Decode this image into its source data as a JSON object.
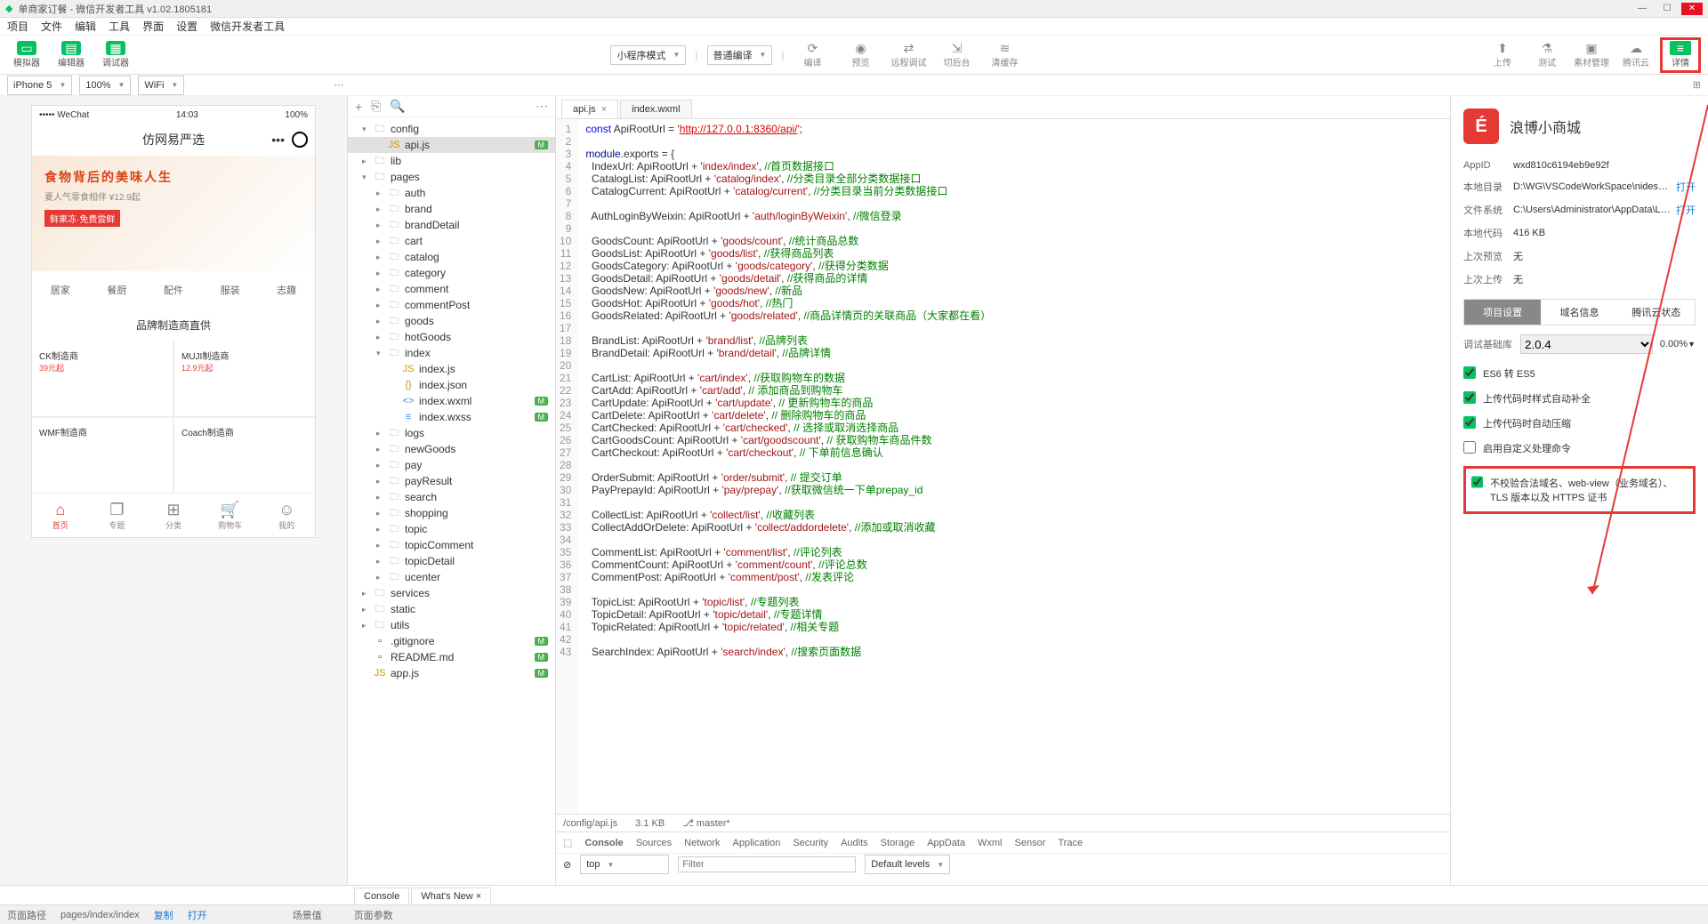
{
  "window": {
    "title": "单商家订餐 - 微信开发者工具 v1.02.1805181"
  },
  "menu": [
    "项目",
    "文件",
    "编辑",
    "工具",
    "界面",
    "设置",
    "微信开发者工具"
  ],
  "toolbar": {
    "sim": "模拟器",
    "editor": "编辑器",
    "debug": "调试器",
    "mode": "小程序模式",
    "compile_mode": "普通编译",
    "compile": "编译",
    "preview": "预览",
    "remote": "远程调试",
    "bg": "切后台",
    "cache": "清缓存",
    "upload": "上传",
    "test": "测试",
    "material": "素材管理",
    "cloud": "腾讯云",
    "detail": "详情"
  },
  "device": {
    "name": "iPhone 5",
    "zoom": "100%",
    "network": "WiFi"
  },
  "phone": {
    "carrier": "••••• WeChat",
    "sig": "⌁",
    "time": "14:03",
    "bat": "100%",
    "title": "仿网易严选",
    "banner": {
      "h": "食物背后的美味人生",
      "p": "夏人气零食相伴 ¥12.9起",
      "tag": "鲜果冻·免费尝鲜"
    },
    "navtabs": [
      "居家",
      "餐厨",
      "配件",
      "服装",
      "志趣"
    ],
    "brand_title": "品牌制造商直供",
    "brands": [
      {
        "name": "CK制造商",
        "price": "39元起"
      },
      {
        "name": "MUJI制造商",
        "price": "12.9元起"
      },
      {
        "name": "WMF制造商",
        "price": ""
      },
      {
        "name": "Coach制造商",
        "price": ""
      }
    ],
    "tabbar": [
      {
        "icon": "⌂",
        "label": "首页"
      },
      {
        "icon": "❐",
        "label": "专题"
      },
      {
        "icon": "⊞",
        "label": "分类"
      },
      {
        "icon": "🛒",
        "label": "购物车"
      },
      {
        "icon": "☺",
        "label": "我的"
      }
    ]
  },
  "tree_head_icons": [
    "+",
    "⎘",
    "Q"
  ],
  "files": [
    {
      "d": 1,
      "t": "folder",
      "open": true,
      "n": "config"
    },
    {
      "d": 2,
      "t": "js",
      "n": "api.js",
      "badge": "M",
      "sel": true,
      "green": true
    },
    {
      "d": 1,
      "t": "folder",
      "open": false,
      "n": "lib"
    },
    {
      "d": 1,
      "t": "folder",
      "open": true,
      "n": "pages"
    },
    {
      "d": 2,
      "t": "folder",
      "open": false,
      "n": "auth"
    },
    {
      "d": 2,
      "t": "folder",
      "open": false,
      "n": "brand"
    },
    {
      "d": 2,
      "t": "folder",
      "open": false,
      "n": "brandDetail"
    },
    {
      "d": 2,
      "t": "folder",
      "open": false,
      "n": "cart"
    },
    {
      "d": 2,
      "t": "folder",
      "open": false,
      "n": "catalog"
    },
    {
      "d": 2,
      "t": "folder",
      "open": false,
      "n": "category"
    },
    {
      "d": 2,
      "t": "folder",
      "open": false,
      "n": "comment"
    },
    {
      "d": 2,
      "t": "folder",
      "open": false,
      "n": "commentPost"
    },
    {
      "d": 2,
      "t": "folder",
      "open": false,
      "n": "goods"
    },
    {
      "d": 2,
      "t": "folder",
      "open": false,
      "n": "hotGoods"
    },
    {
      "d": 2,
      "t": "folder",
      "open": true,
      "n": "index"
    },
    {
      "d": 3,
      "t": "js",
      "n": "index.js"
    },
    {
      "d": 3,
      "t": "json",
      "n": "index.json"
    },
    {
      "d": 3,
      "t": "wxml",
      "n": "index.wxml",
      "badge": "M",
      "green": true
    },
    {
      "d": 3,
      "t": "wxss",
      "n": "index.wxss",
      "badge": "M",
      "green": true
    },
    {
      "d": 2,
      "t": "folder",
      "open": false,
      "n": "logs"
    },
    {
      "d": 2,
      "t": "folder",
      "open": false,
      "n": "newGoods"
    },
    {
      "d": 2,
      "t": "folder",
      "open": false,
      "n": "pay"
    },
    {
      "d": 2,
      "t": "folder",
      "open": false,
      "n": "payResult"
    },
    {
      "d": 2,
      "t": "folder",
      "open": false,
      "n": "search"
    },
    {
      "d": 2,
      "t": "folder",
      "open": false,
      "n": "shopping"
    },
    {
      "d": 2,
      "t": "folder",
      "open": false,
      "n": "topic"
    },
    {
      "d": 2,
      "t": "folder",
      "open": false,
      "n": "topicComment"
    },
    {
      "d": 2,
      "t": "folder",
      "open": false,
      "n": "topicDetail"
    },
    {
      "d": 2,
      "t": "folder",
      "open": false,
      "n": "ucenter"
    },
    {
      "d": 1,
      "t": "folder",
      "open": false,
      "n": "services"
    },
    {
      "d": 1,
      "t": "folder",
      "open": false,
      "n": "static"
    },
    {
      "d": 1,
      "t": "folder",
      "open": false,
      "n": "utils"
    },
    {
      "d": 1,
      "t": "file",
      "n": ".gitignore",
      "badge": "M",
      "green": true
    },
    {
      "d": 1,
      "t": "file",
      "n": "README.md",
      "badge": "M",
      "green": true
    },
    {
      "d": 1,
      "t": "js",
      "n": "app.js",
      "badge": "M",
      "green": true
    }
  ],
  "editor_tabs": [
    {
      "name": "api.js",
      "active": true
    },
    {
      "name": "index.wxml",
      "active": false
    }
  ],
  "code": [
    [
      {
        "k": "kw",
        "t": "const"
      },
      {
        "t": " ApiRootUrl = "
      },
      {
        "k": "str",
        "t": "'"
      },
      {
        "k": "url",
        "t": "http://127.0.0.1:8360/api/"
      },
      {
        "k": "str",
        "t": "'"
      },
      {
        "t": ";"
      }
    ],
    [],
    [
      {
        "k": "prop",
        "t": "module"
      },
      {
        "t": ".exports = {"
      }
    ],
    [
      {
        "t": "  IndexUrl: ApiRootUrl + "
      },
      {
        "k": "str",
        "t": "'index/index'"
      },
      {
        "t": ", "
      },
      {
        "k": "com",
        "t": "//首页数据接口"
      }
    ],
    [
      {
        "t": "  CatalogList: ApiRootUrl + "
      },
      {
        "k": "str",
        "t": "'catalog/index'"
      },
      {
        "t": ", "
      },
      {
        "k": "com",
        "t": "//分类目录全部分类数据接口"
      }
    ],
    [
      {
        "t": "  CatalogCurrent: ApiRootUrl + "
      },
      {
        "k": "str",
        "t": "'catalog/current'"
      },
      {
        "t": ", "
      },
      {
        "k": "com",
        "t": "//分类目录当前分类数据接口"
      }
    ],
    [],
    [
      {
        "t": "  AuthLoginByWeixin: ApiRootUrl + "
      },
      {
        "k": "str",
        "t": "'auth/loginByWeixin'"
      },
      {
        "t": ", "
      },
      {
        "k": "com",
        "t": "//微信登录"
      }
    ],
    [],
    [
      {
        "t": "  GoodsCount: ApiRootUrl + "
      },
      {
        "k": "str",
        "t": "'goods/count'"
      },
      {
        "t": ", "
      },
      {
        "k": "com",
        "t": "//统计商品总数"
      }
    ],
    [
      {
        "t": "  GoodsList: ApiRootUrl + "
      },
      {
        "k": "str",
        "t": "'goods/list'"
      },
      {
        "t": ", "
      },
      {
        "k": "com",
        "t": "//获得商品列表"
      }
    ],
    [
      {
        "t": "  GoodsCategory: ApiRootUrl + "
      },
      {
        "k": "str",
        "t": "'goods/category'"
      },
      {
        "t": ", "
      },
      {
        "k": "com",
        "t": "//获得分类数据"
      }
    ],
    [
      {
        "t": "  GoodsDetail: ApiRootUrl + "
      },
      {
        "k": "str",
        "t": "'goods/detail'"
      },
      {
        "t": ", "
      },
      {
        "k": "com",
        "t": "//获得商品的详情"
      }
    ],
    [
      {
        "t": "  GoodsNew: ApiRootUrl + "
      },
      {
        "k": "str",
        "t": "'goods/new'"
      },
      {
        "t": ", "
      },
      {
        "k": "com",
        "t": "//新品"
      }
    ],
    [
      {
        "t": "  GoodsHot: ApiRootUrl + "
      },
      {
        "k": "str",
        "t": "'goods/hot'"
      },
      {
        "t": ", "
      },
      {
        "k": "com",
        "t": "//热门"
      }
    ],
    [
      {
        "t": "  GoodsRelated: ApiRootUrl + "
      },
      {
        "k": "str",
        "t": "'goods/related'"
      },
      {
        "t": ", "
      },
      {
        "k": "com",
        "t": "//商品详情页的关联商品（大家都在看）"
      }
    ],
    [],
    [
      {
        "t": "  BrandList: ApiRootUrl + "
      },
      {
        "k": "str",
        "t": "'brand/list'"
      },
      {
        "t": ", "
      },
      {
        "k": "com",
        "t": "//品牌列表"
      }
    ],
    [
      {
        "t": "  BrandDetail: ApiRootUrl + "
      },
      {
        "k": "str",
        "t": "'brand/detail'"
      },
      {
        "t": ", "
      },
      {
        "k": "com",
        "t": "//品牌详情"
      }
    ],
    [],
    [
      {
        "t": "  CartList: ApiRootUrl + "
      },
      {
        "k": "str",
        "t": "'cart/index'"
      },
      {
        "t": ", "
      },
      {
        "k": "com",
        "t": "//获取购物车的数据"
      }
    ],
    [
      {
        "t": "  CartAdd: ApiRootUrl + "
      },
      {
        "k": "str",
        "t": "'cart/add'"
      },
      {
        "t": ", "
      },
      {
        "k": "com",
        "t": "// 添加商品到购物车"
      }
    ],
    [
      {
        "t": "  CartUpdate: ApiRootUrl + "
      },
      {
        "k": "str",
        "t": "'cart/update'"
      },
      {
        "t": ", "
      },
      {
        "k": "com",
        "t": "// 更新购物车的商品"
      }
    ],
    [
      {
        "t": "  CartDelete: ApiRootUrl + "
      },
      {
        "k": "str",
        "t": "'cart/delete'"
      },
      {
        "t": ", "
      },
      {
        "k": "com",
        "t": "// 删除购物车的商品"
      }
    ],
    [
      {
        "t": "  CartChecked: ApiRootUrl + "
      },
      {
        "k": "str",
        "t": "'cart/checked'"
      },
      {
        "t": ", "
      },
      {
        "k": "com",
        "t": "// 选择或取消选择商品"
      }
    ],
    [
      {
        "t": "  CartGoodsCount: ApiRootUrl + "
      },
      {
        "k": "str",
        "t": "'cart/goodscount'"
      },
      {
        "t": ", "
      },
      {
        "k": "com",
        "t": "// 获取购物车商品件数"
      }
    ],
    [
      {
        "t": "  CartCheckout: ApiRootUrl + "
      },
      {
        "k": "str",
        "t": "'cart/checkout'"
      },
      {
        "t": ", "
      },
      {
        "k": "com",
        "t": "// 下单前信息确认"
      }
    ],
    [],
    [
      {
        "t": "  OrderSubmit: ApiRootUrl + "
      },
      {
        "k": "str",
        "t": "'order/submit'"
      },
      {
        "t": ", "
      },
      {
        "k": "com",
        "t": "// 提交订单"
      }
    ],
    [
      {
        "t": "  PayPrepayId: ApiRootUrl + "
      },
      {
        "k": "str",
        "t": "'pay/prepay'"
      },
      {
        "t": ", "
      },
      {
        "k": "com",
        "t": "//获取微信统一下单prepay_id"
      }
    ],
    [],
    [
      {
        "t": "  CollectList: ApiRootUrl + "
      },
      {
        "k": "str",
        "t": "'collect/list'"
      },
      {
        "t": ", "
      },
      {
        "k": "com",
        "t": "//收藏列表"
      }
    ],
    [
      {
        "t": "  CollectAddOrDelete: ApiRootUrl + "
      },
      {
        "k": "str",
        "t": "'collect/addordelete'"
      },
      {
        "t": ", "
      },
      {
        "k": "com",
        "t": "//添加或取消收藏"
      }
    ],
    [],
    [
      {
        "t": "  CommentList: ApiRootUrl + "
      },
      {
        "k": "str",
        "t": "'comment/list'"
      },
      {
        "t": ", "
      },
      {
        "k": "com",
        "t": "//评论列表"
      }
    ],
    [
      {
        "t": "  CommentCount: ApiRootUrl + "
      },
      {
        "k": "str",
        "t": "'comment/count'"
      },
      {
        "t": ", "
      },
      {
        "k": "com",
        "t": "//评论总数"
      }
    ],
    [
      {
        "t": "  CommentPost: ApiRootUrl + "
      },
      {
        "k": "str",
        "t": "'comment/post'"
      },
      {
        "t": ", "
      },
      {
        "k": "com",
        "t": "//发表评论"
      }
    ],
    [],
    [
      {
        "t": "  TopicList: ApiRootUrl + "
      },
      {
        "k": "str",
        "t": "'topic/list'"
      },
      {
        "t": ", "
      },
      {
        "k": "com",
        "t": "//专题列表"
      }
    ],
    [
      {
        "t": "  TopicDetail: ApiRootUrl + "
      },
      {
        "k": "str",
        "t": "'topic/detail'"
      },
      {
        "t": ", "
      },
      {
        "k": "com",
        "t": "//专题详情"
      }
    ],
    [
      {
        "t": "  TopicRelated: ApiRootUrl + "
      },
      {
        "k": "str",
        "t": "'topic/related'"
      },
      {
        "t": ", "
      },
      {
        "k": "com",
        "t": "//相关专题"
      }
    ],
    [],
    [
      {
        "t": "  SearchIndex: ApiRootUrl + "
      },
      {
        "k": "str",
        "t": "'search/index'"
      },
      {
        "t": ", "
      },
      {
        "k": "com",
        "t": "//搜索页面数据"
      }
    ]
  ],
  "editor_status": {
    "path": "/config/api.js",
    "size": "3.1 KB",
    "branch": "master*"
  },
  "devtools": {
    "tabs": [
      "Console",
      "Sources",
      "Network",
      "Application",
      "Security",
      "Audits",
      "Storage",
      "AppData",
      "Wxml",
      "Sensor",
      "Trace"
    ],
    "filter_ph": "Filter",
    "levels": "Default levels",
    "top": "top"
  },
  "detail": {
    "app_name": "浪博小商城",
    "rows": [
      {
        "lbl": "AppID",
        "val": "wxd810c6194eb9e92f"
      },
      {
        "lbl": "本地目录",
        "val": "D:\\WG\\VSCodeWorkSpace\\nideshop-mi...",
        "link": "打开"
      },
      {
        "lbl": "文件系统",
        "val": "C:\\Users\\Administrator\\AppData\\Local\\...",
        "link": "打开"
      },
      {
        "lbl": "本地代码",
        "val": "416 KB"
      },
      {
        "lbl": "上次预览",
        "val": "无"
      },
      {
        "lbl": "上次上传",
        "val": "无"
      }
    ],
    "tabs": [
      "项目设置",
      "域名信息",
      "腾讯云状态"
    ],
    "lib_label": "调试基础库",
    "lib_ver": "2.0.4",
    "lib_pct": "0.00%",
    "checks": [
      {
        "checked": true,
        "label": "ES6 转 ES5"
      },
      {
        "checked": true,
        "label": "上传代码时样式自动补全"
      },
      {
        "checked": true,
        "label": "上传代码时自动压缩"
      },
      {
        "checked": false,
        "label": "启用自定义处理命令"
      }
    ],
    "final_check": "不校验合法域名、web-view（业务域名）、TLS 版本以及 HTTPS 证书"
  },
  "bottom": {
    "path_lbl": "页面路径",
    "path": "pages/index/index",
    "copy": "复制",
    "open": "打开",
    "scene": "场景值",
    "param": "页面参数"
  },
  "subtabs": [
    "Console",
    "What's New ×"
  ]
}
